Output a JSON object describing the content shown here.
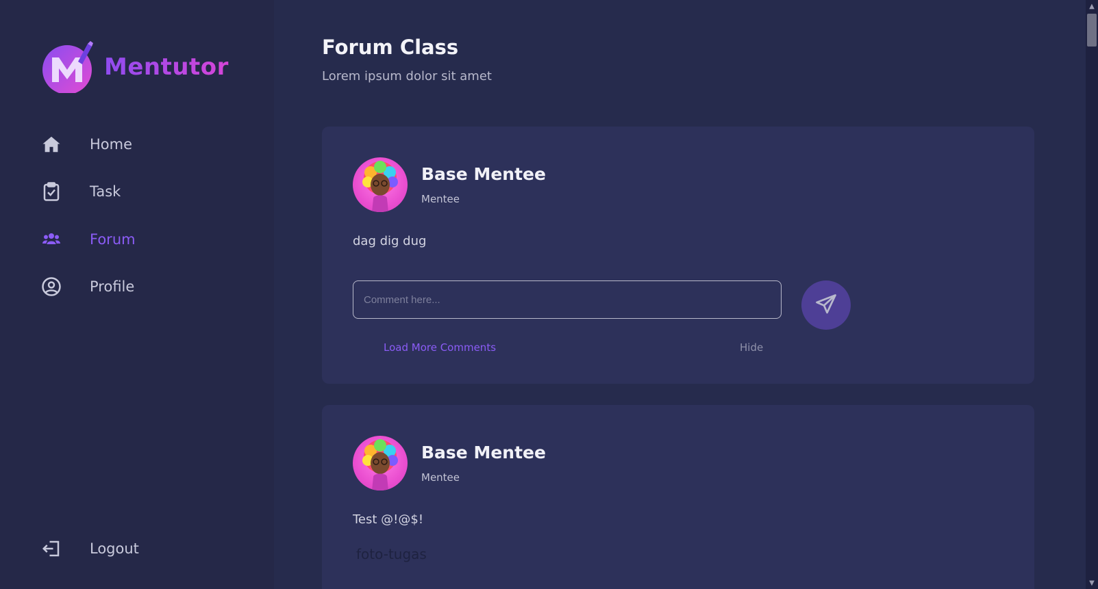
{
  "brand": {
    "name": "Mentutor",
    "accent": "#8b5cf6",
    "gradient": [
      "#8f4cf0",
      "#d645d8"
    ]
  },
  "sidebar": {
    "items": [
      {
        "label": "Home",
        "icon": "home-icon",
        "active": false
      },
      {
        "label": "Task",
        "icon": "clipboard-check-icon",
        "active": false
      },
      {
        "label": "Forum",
        "icon": "users-icon",
        "active": true
      },
      {
        "label": "Profile",
        "icon": "user-circle-icon",
        "active": false
      }
    ],
    "logout": {
      "label": "Logout",
      "icon": "logout-icon"
    }
  },
  "header": {
    "title": "Forum Class",
    "subtitle": "Lorem ipsum dolor sit amet"
  },
  "posts": [
    {
      "author": "Base Mentee",
      "role": "Mentee",
      "body": "dag dig dug",
      "comment_placeholder": "Comment here...",
      "load_more_label": "Load More Comments",
      "hide_label": "Hide"
    },
    {
      "author": "Base Mentee",
      "role": "Mentee",
      "body": "Test @!@$!",
      "attachment_alt": "foto-tugas"
    }
  ],
  "colors": {
    "background": "#262b4d",
    "sidebar": "#252848",
    "card": "#2d315a",
    "send_button": "#4e3f96"
  }
}
